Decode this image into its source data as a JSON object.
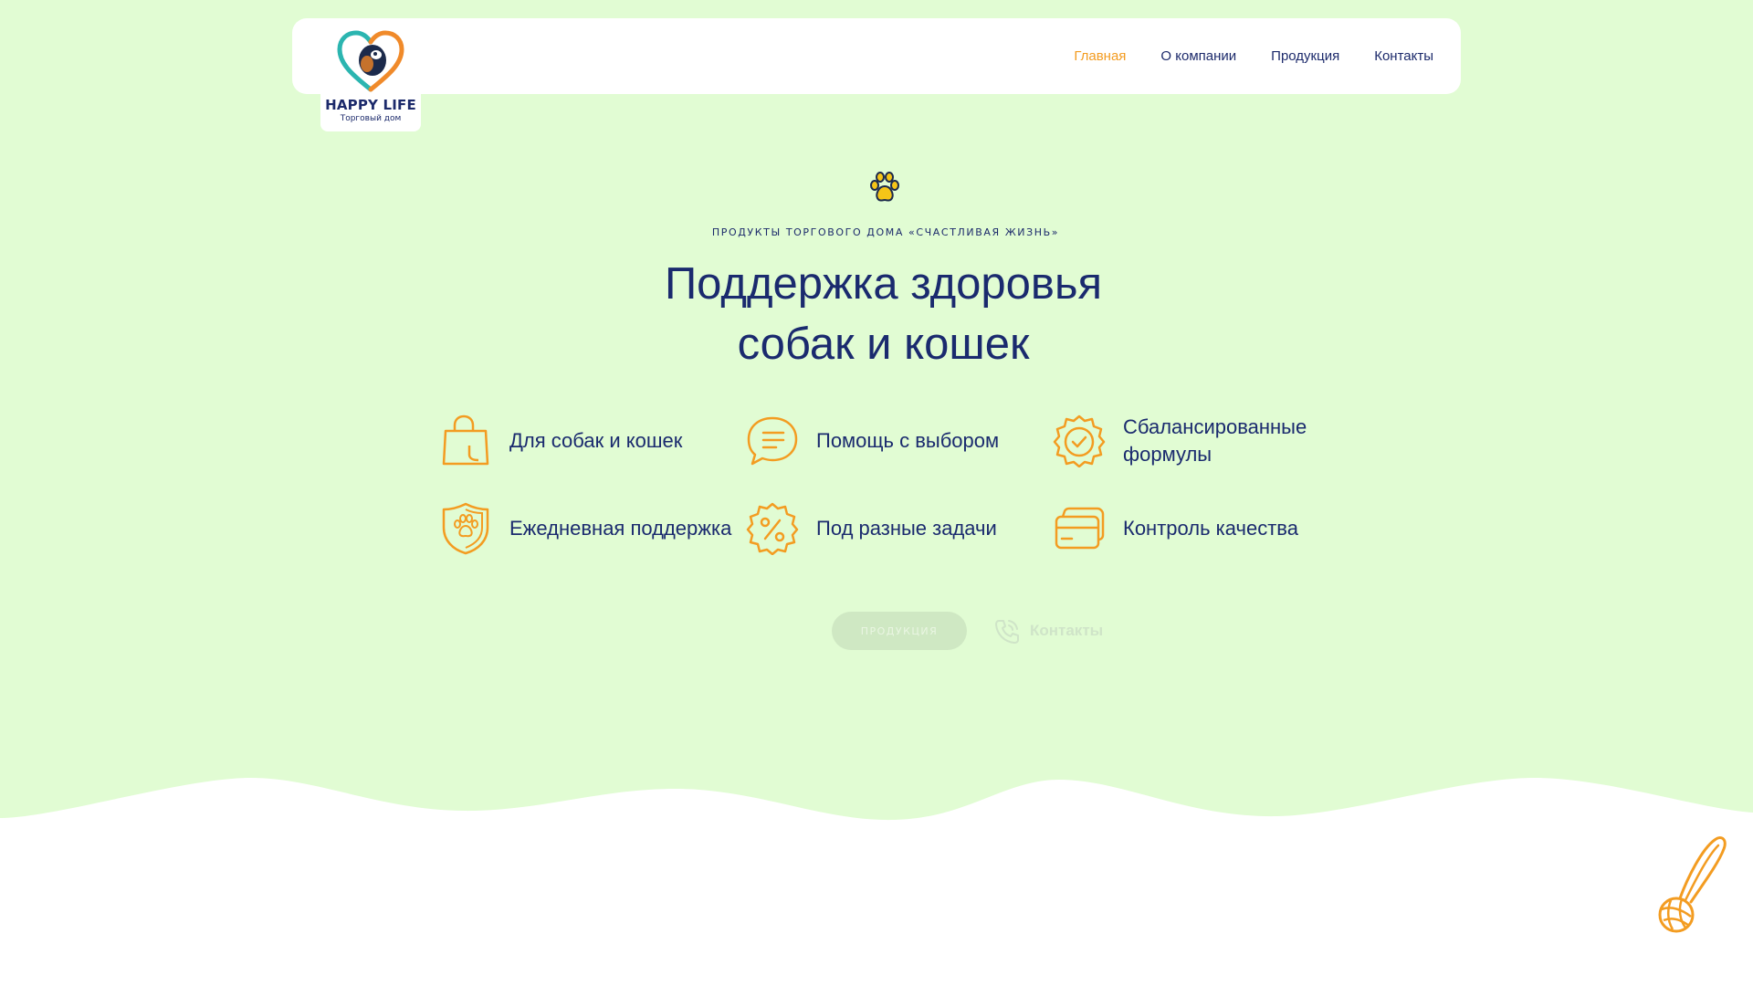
{
  "brand": {
    "name": "HAPPY LIFE",
    "tagline": "Торговый дом"
  },
  "nav": {
    "items": [
      {
        "label": "Главная",
        "active": true
      },
      {
        "label": "О компании",
        "active": false
      },
      {
        "label": "Продукция",
        "active": false
      },
      {
        "label": "Контакты",
        "active": false
      }
    ]
  },
  "hero": {
    "eyebrow": "ПРОДУКТЫ ТОРГОВОГО ДОМА «СЧАСТЛИВАЯ ЖИЗНЬ»",
    "title_line1": "Поддержка здоровья",
    "title_line2": "собак и кошек",
    "icon": "paw-icon"
  },
  "features": [
    {
      "label": "Для собак и кошек",
      "icon": "shopping-bag-icon"
    },
    {
      "label": "Помощь с выбором",
      "icon": "chat-bubble-icon"
    },
    {
      "label": "Сбалансированные\nформулы",
      "icon": "verified-badge-icon"
    },
    {
      "label": "Ежедневная поддержка",
      "icon": "paw-shield-icon"
    },
    {
      "label": "Под разные задачи",
      "icon": "percent-badge-icon"
    },
    {
      "label": "Контроль качества",
      "icon": "credit-card-icon"
    }
  ],
  "actions": {
    "products_label": "ПРОДУКЦИЯ",
    "contacts_label": "Контакты"
  },
  "colors": {
    "background": "#e1fcd3",
    "accent": "#f39c21",
    "text": "#1a2a6e",
    "paw": "#f5c518"
  }
}
